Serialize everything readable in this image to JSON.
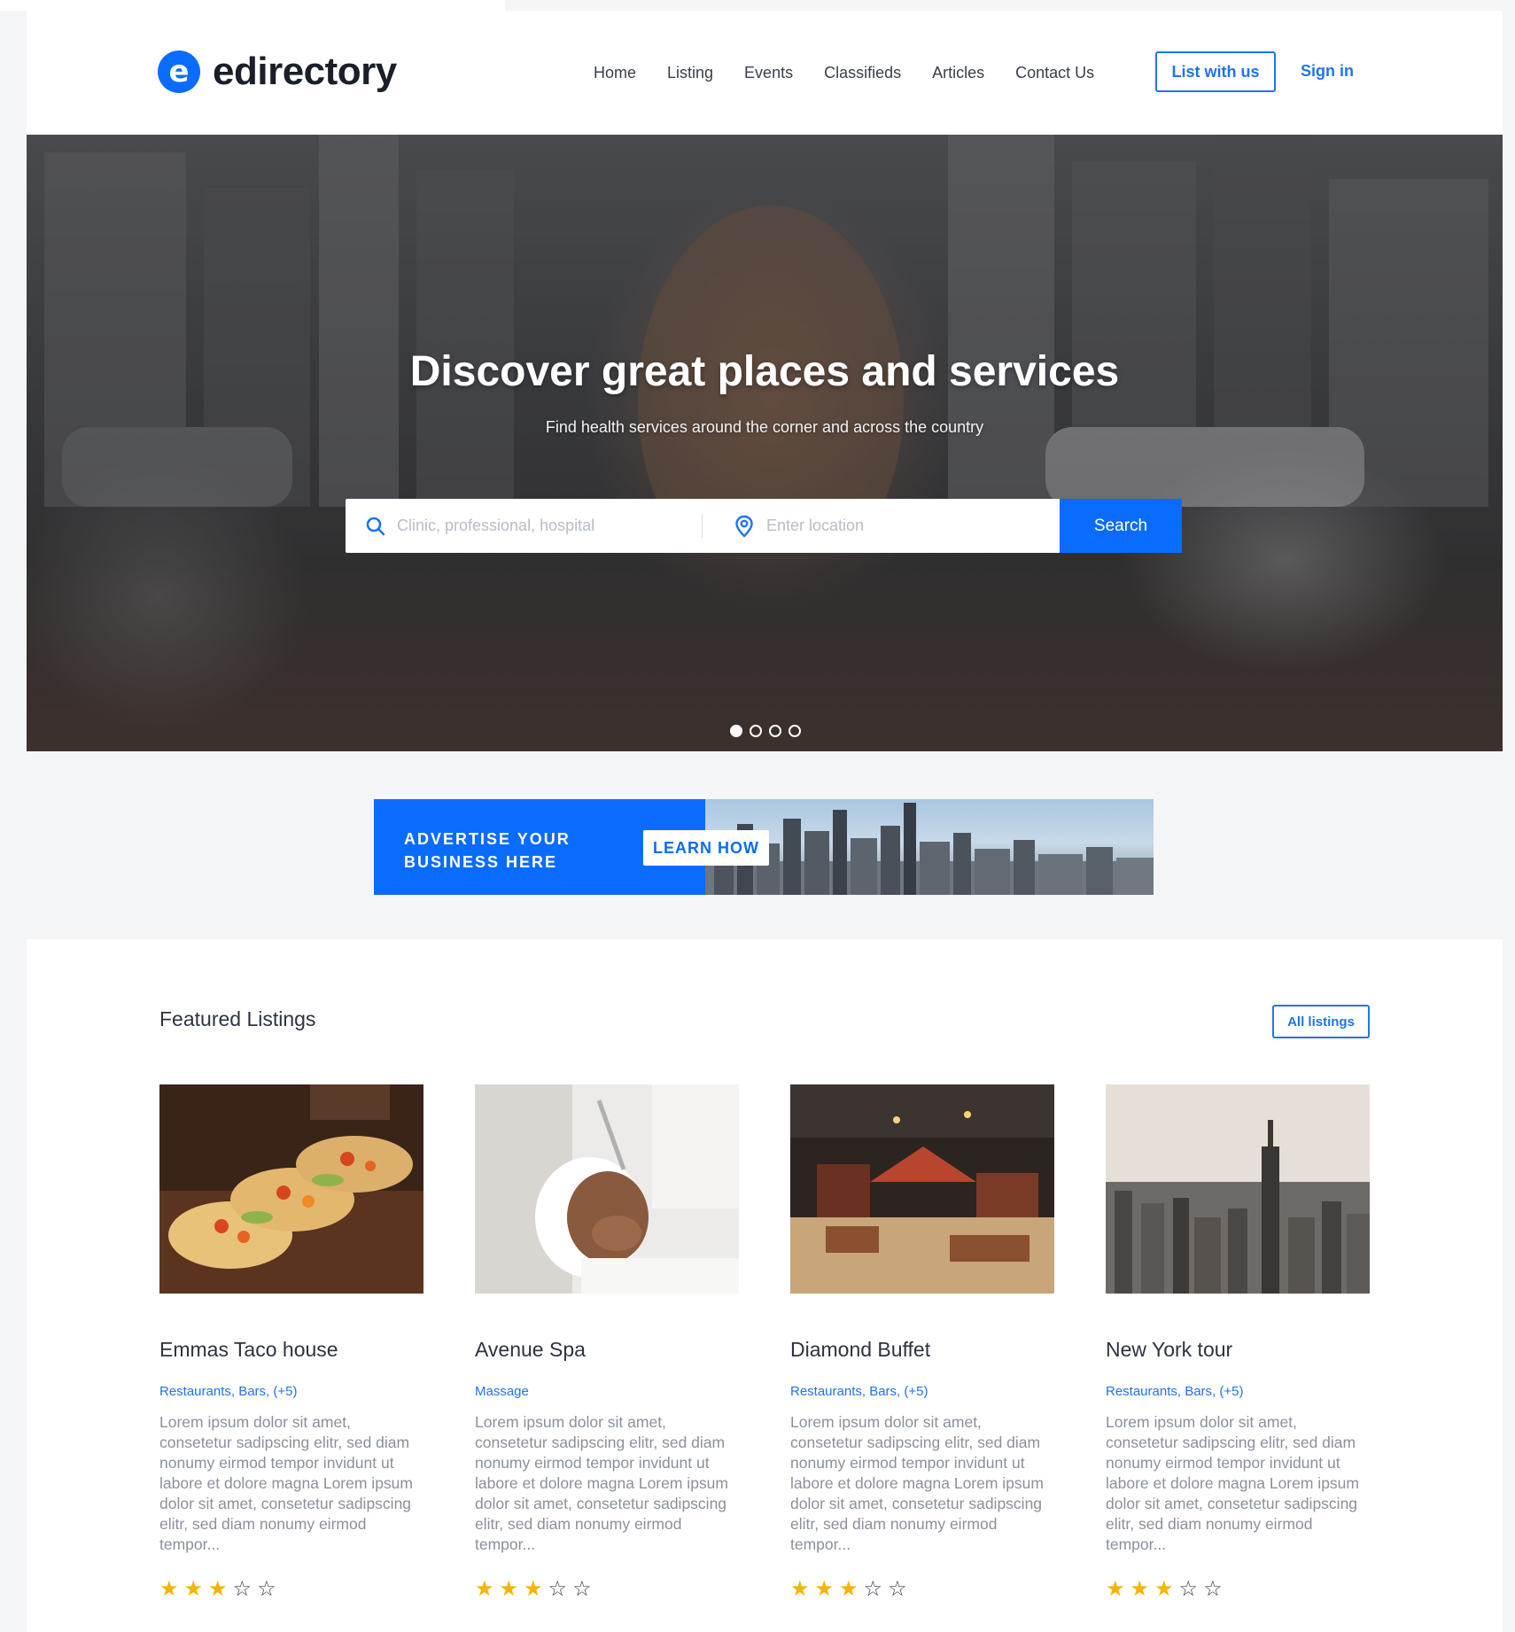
{
  "brand": {
    "logo_letter": "e",
    "name": "edirectory",
    "accent": "#0a6cff"
  },
  "nav": {
    "items": [
      "Home",
      "Listing",
      "Events",
      "Classifieds",
      "Articles",
      "Contact Us"
    ],
    "list_button": "List with us",
    "signin": "Sign in"
  },
  "hero": {
    "title": "Discover great places and services",
    "subtitle": "Find health services around the corner and across the country",
    "search_placeholder": "Clinic, professional, hospital",
    "location_placeholder": "Enter location",
    "search_button": "Search",
    "slides_total": 4,
    "active_slide": 1
  },
  "ad": {
    "line1": "ADVERTISE YOUR",
    "line2": "BUSINESS HERE",
    "button": "LEARN HOW"
  },
  "featured": {
    "title": "Featured Listings",
    "all_button": "All listings",
    "listings": [
      {
        "title": "Emmas Taco house",
        "categories": "Restaurants, Bars, (+5)",
        "description": "Lorem ipsum dolor sit amet, consetetur sadipscing elitr, sed diam nonumy eirmod tempor invidunt ut labore et dolore magna Lorem ipsum dolor sit amet, consetetur sadipscing elitr, sed diam nonumy eirmod tempor...",
        "rating": 3,
        "rating_max": 5,
        "image": "tacos-photo"
      },
      {
        "title": "Avenue Spa",
        "categories": "Massage",
        "description": "Lorem ipsum dolor sit amet, consetetur sadipscing elitr, sed diam nonumy eirmod tempor invidunt ut labore et dolore magna Lorem ipsum dolor sit amet, consetetur sadipscing elitr, sed diam nonumy eirmod tempor...",
        "rating": 3,
        "rating_max": 5,
        "image": "spa-facial-photo"
      },
      {
        "title": "Diamond Buffet",
        "categories": "Restaurants, Bars, (+5)",
        "description": "Lorem ipsum dolor sit amet, consetetur sadipscing elitr, sed diam nonumy eirmod tempor invidunt ut labore et dolore magna Lorem ipsum dolor sit amet, consetetur sadipscing elitr, sed diam nonumy eirmod tempor...",
        "rating": 3,
        "rating_max": 5,
        "image": "restaurant-interior-photo"
      },
      {
        "title": "New York tour",
        "categories": "Restaurants, Bars, (+5)",
        "description": "Lorem ipsum dolor sit amet, consetetur sadipscing elitr, sed diam nonumy eirmod tempor invidunt ut labore et dolore magna Lorem ipsum dolor sit amet, consetetur sadipscing elitr, sed diam nonumy eirmod tempor...",
        "rating": 3,
        "rating_max": 5,
        "image": "new-york-skyline-photo"
      }
    ]
  }
}
